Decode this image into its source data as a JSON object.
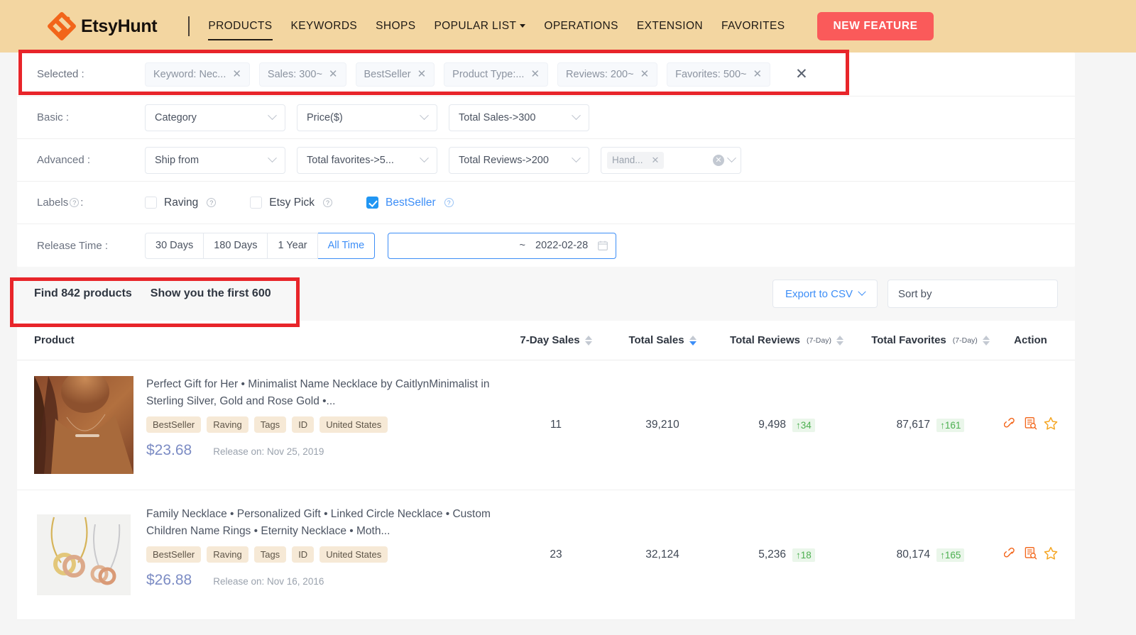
{
  "brand": {
    "name": "EtsyHunt",
    "logo_icon": "etsyhunt-logo-icon"
  },
  "nav": {
    "items": [
      {
        "label": "PRODUCTS",
        "active": true,
        "has_caret": false
      },
      {
        "label": "KEYWORDS",
        "active": false,
        "has_caret": false
      },
      {
        "label": "SHOPS",
        "active": false,
        "has_caret": false
      },
      {
        "label": "POPULAR LIST",
        "active": false,
        "has_caret": true
      },
      {
        "label": "OPERATIONS",
        "active": false,
        "has_caret": false
      },
      {
        "label": "EXTENSION",
        "active": false,
        "has_caret": false
      },
      {
        "label": "FAVORITES",
        "active": false,
        "has_caret": false
      }
    ],
    "cta": "NEW FEATURE"
  },
  "filters": {
    "selected": {
      "label": "Selected :",
      "chips": [
        "Keyword: Nec...",
        "Sales: 300~",
        "BestSeller",
        "Product Type:...",
        "Reviews: 200~",
        "Favorites: 500~"
      ],
      "clear_all": "✕"
    },
    "basic": {
      "label": "Basic :",
      "selects": [
        "Category",
        "Price($)",
        "Total Sales->300"
      ]
    },
    "advanced": {
      "label": "Advanced :",
      "selects": [
        "Ship from",
        "Total favorites->5...",
        "Total Reviews->200"
      ],
      "multi_chip": "Hand..."
    },
    "labels": {
      "label": "Labels",
      "suffix": ":",
      "options": [
        {
          "text": "Raving",
          "checked": false
        },
        {
          "text": "Etsy Pick",
          "checked": false
        },
        {
          "text": "BestSeller",
          "checked": true
        }
      ]
    },
    "release_time": {
      "label": "Release Time :",
      "segments": [
        {
          "text": "30 Days",
          "active": false
        },
        {
          "text": "180 Days",
          "active": false
        },
        {
          "text": "1 Year",
          "active": false
        },
        {
          "text": "All Time",
          "active": true
        }
      ],
      "range_separator": "~",
      "range_end": "2022-02-28"
    }
  },
  "results": {
    "found": "Find 842 products",
    "showing": "Show you the first 600",
    "export_label": "Export to CSV",
    "sort_label": "Sort by"
  },
  "table": {
    "columns": [
      {
        "label": "Product",
        "sub": "",
        "sortable": false
      },
      {
        "label": "7-Day Sales",
        "sub": "",
        "sortable": true,
        "active": false
      },
      {
        "label": "Total Sales",
        "sub": "",
        "sortable": true,
        "active": true
      },
      {
        "label": "Total Reviews",
        "sub": "(7-Day)",
        "sortable": true,
        "active": false
      },
      {
        "label": "Total Favorites",
        "sub": "(7-Day)",
        "sortable": true,
        "active": false
      },
      {
        "label": "Action",
        "sub": "",
        "sortable": false
      }
    ],
    "rows": [
      {
        "thumb": "necklace-on-model-photo",
        "title": "Perfect Gift for Her • Minimalist Name Necklace by CaitlynMinimalist in Sterling Silver, Gold and Rose Gold •...",
        "tags": [
          "BestSeller",
          "Raving",
          "Tags",
          "ID",
          "United States"
        ],
        "price": "$23.68",
        "release": "Release on: Nov 25, 2019",
        "seven_day_sales": "11",
        "total_sales": "39,210",
        "total_reviews": "9,498",
        "reviews_delta": "↑34",
        "total_favorites": "87,617",
        "favorites_delta": "↑161"
      },
      {
        "thumb": "two-circle-necklaces-photo",
        "title": "Family Necklace • Personalized Gift • Linked Circle Necklace • Custom Children Name Rings • Eternity Necklace • Moth...",
        "tags": [
          "BestSeller",
          "Raving",
          "Tags",
          "ID",
          "United States"
        ],
        "price": "$26.88",
        "release": "Release on: Nov 16, 2016",
        "seven_day_sales": "23",
        "total_sales": "32,124",
        "total_reviews": "5,236",
        "reviews_delta": "↑18",
        "total_favorites": "80,174",
        "favorites_delta": "↑165"
      }
    ],
    "action_icons": [
      "link-icon",
      "report-search-icon",
      "star-icon"
    ]
  },
  "colors": {
    "header_bg": "#f3d6a1",
    "accent_orange": "#f2651a",
    "accent_blue": "#3d8ef7",
    "cta_red": "#fa5a5a",
    "annotation_red": "#e8252a",
    "delta_green": "#4caf50"
  }
}
